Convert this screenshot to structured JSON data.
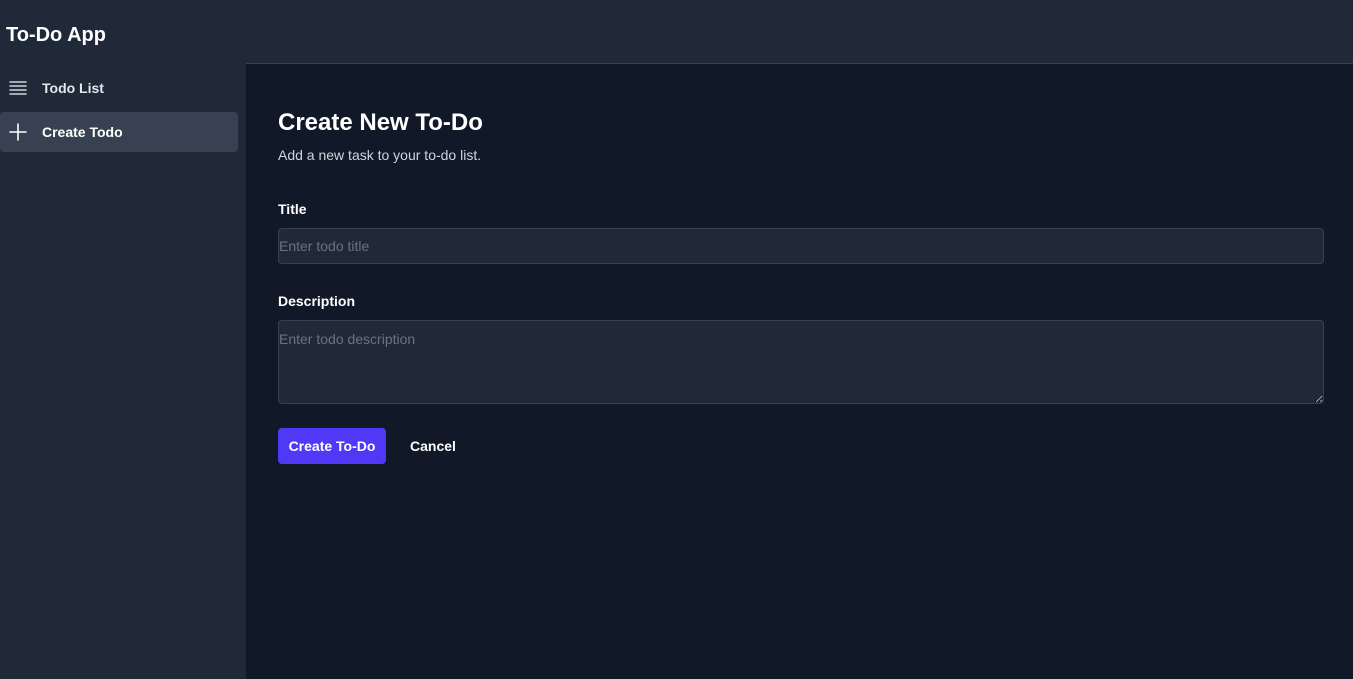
{
  "app": {
    "title": "To-Do App"
  },
  "sidebar": {
    "items": [
      {
        "label": "Todo List",
        "icon": "list-icon",
        "active": false
      },
      {
        "label": "Create Todo",
        "icon": "plus-icon",
        "active": true
      }
    ]
  },
  "page": {
    "title": "Create New To-Do",
    "subtitle": "Add a new task to your to-do list."
  },
  "form": {
    "title_label": "Title",
    "title_placeholder": "Enter todo title",
    "title_value": "",
    "description_label": "Description",
    "description_placeholder": "Enter todo description",
    "description_value": "",
    "submit_label": "Create To-Do",
    "cancel_label": "Cancel"
  },
  "colors": {
    "sidebar_bg": "#1f2937",
    "main_bg": "#111827",
    "active_item_bg": "#374151",
    "primary_button": "#4f39f6"
  }
}
